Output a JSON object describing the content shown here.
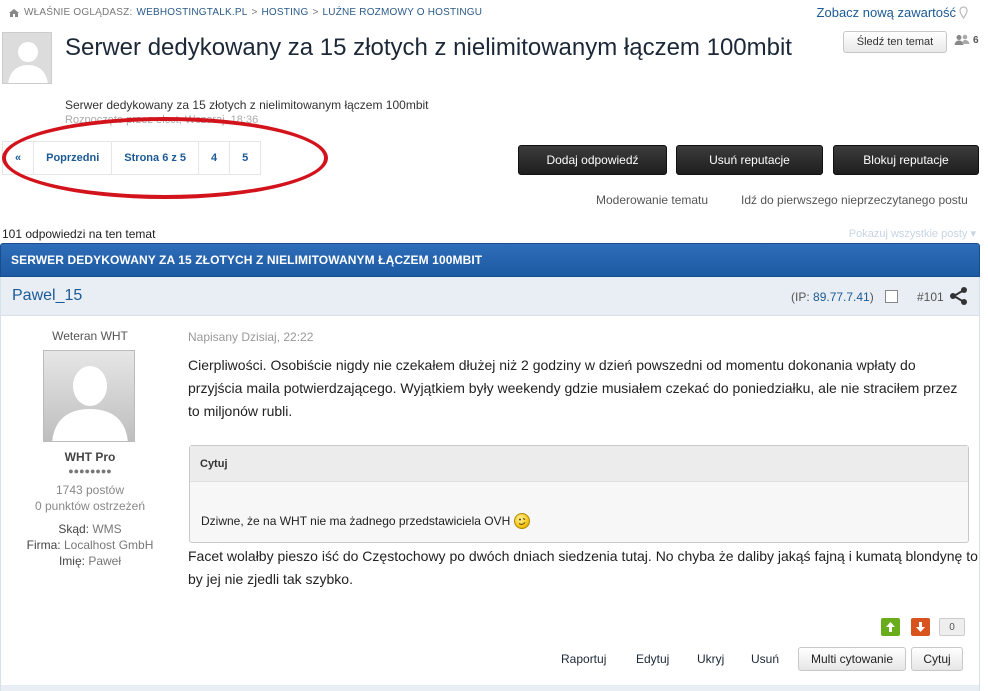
{
  "breadcrumb": {
    "label": "WŁAŚNIE OGLĄDASZ:",
    "items": [
      "WEBHOSTINGTALK.PL",
      "HOSTING",
      "LUŹNE ROZMOWY O HOSTINGU"
    ],
    "sep": ">"
  },
  "header": {
    "new_content": "Zobacz nową zawartość",
    "follow": "Śledź ten temat",
    "followers": "6"
  },
  "topic": {
    "title": "Serwer dedykowany za 15 złotych z nielimitowanym łączem 100mbit",
    "description": "Serwer dedykowany za 15 złotych z nielimitowanym łączem 100mbit",
    "started": "Rozpoczęte przez elcct, Wczoraj, 18:36",
    "bar_title": "SERWER DEDYKOWANY ZA 15 ZŁOTYCH Z NIELIMITOWANYM ŁĄCZEM 100MBIT",
    "reply_count": "101 odpowiedzi na ten temat",
    "show_all": "Pokazuj wszystkie posty"
  },
  "pagination": {
    "first": "«",
    "prev": "Poprzedni",
    "current": "Strona 6 z 5",
    "p4": "4",
    "p5": "5"
  },
  "actions": {
    "add_reply": "Dodaj odpowiedź",
    "remove_rep": "Usuń reputacje",
    "block_rep": "Blokuj reputacje",
    "moderate": "Moderowanie tematu",
    "first_unread": "Idź do pierwszego nieprzeczytanego postu"
  },
  "post": {
    "author": "Pawel_15",
    "ip_label": "(IP: ",
    "ip": "89.77.7.41",
    "ip_close": ")",
    "number": "#101",
    "group": "Weteran WHT",
    "title": "WHT Pro",
    "pips": "●●●●●●●●",
    "posts": "1743 postów",
    "warnings": "0 punktów ostrzeżeń",
    "from_label": "Skąd:",
    "from": "WMS",
    "company_label": "Firma:",
    "company": "Localhost GmbH",
    "name_label": "Imię:",
    "name": "Paweł",
    "date": "Napisany Dzisiaj, 22:22",
    "body": "Cierpliwości. Osobiście nigdy nie czekałem dłużej niż 2 godziny w dzień powszedni od momentu dokonania wpłaty do przyjścia maila potwierdzającego. Wyjątkiem były weekendy gdzie musiałem czekać do poniedziałku, ale nie straciłem przez to miljonów rubli.",
    "quote_label": "Cytuj",
    "quote_text": "Dziwne, że na WHT nie ma żadnego przedstawiciela OVH",
    "body2": "Facet wolałby pieszo iść do Częstochowy po dwóch dniach siedzenia tutaj. No chyba że daliby jakąś fajną i kumatą blondynę to by jej nie zjedli tak szybko.",
    "rep": "0",
    "report": "Raportuj",
    "edit": "Edytuj",
    "hide": "Ukryj",
    "delete": "Usuń",
    "multiquote": "Multi cytowanie",
    "quote": "Cytuj"
  },
  "colors": {
    "accent": "#1b5a96",
    "bar": "#2e6db8",
    "highlight": "#d3131c",
    "rep_up": "#6aad1c",
    "rep_down": "#d9531e"
  }
}
